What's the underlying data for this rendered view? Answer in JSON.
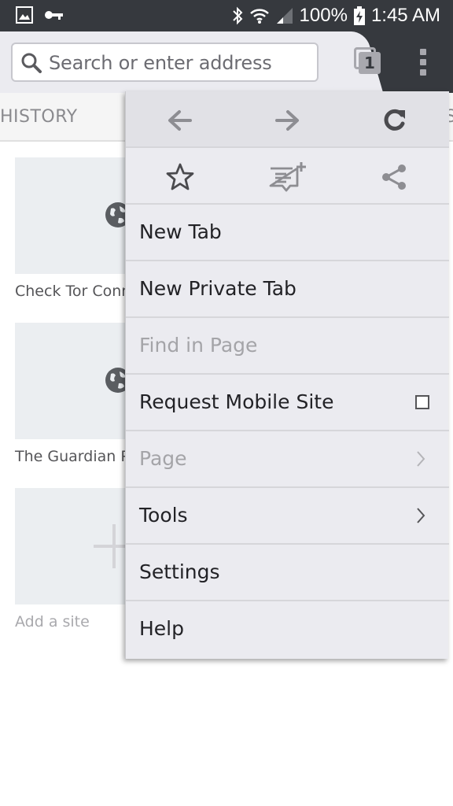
{
  "status_bar": {
    "battery": "100%",
    "time": "1:45 AM",
    "icons": [
      "gallery-icon",
      "key-icon",
      "bluetooth-icon",
      "wifi-icon",
      "signal-icon",
      "battery-charging-icon"
    ]
  },
  "toolbar": {
    "search_placeholder": "Search or enter address",
    "tab_count": "1"
  },
  "panel_tabs": {
    "history_label": "HISTORY",
    "partial_next_label": "S"
  },
  "top_sites": [
    {
      "label": "Check Tor Conne",
      "icon": "globe-icon"
    },
    {
      "label": "The Guardian Pr",
      "icon": "globe-icon"
    },
    {
      "label": "Add a site",
      "icon": "plus-icon"
    }
  ],
  "menu": {
    "nav_icons": [
      "back-arrow-icon",
      "forward-arrow-icon",
      "reload-icon"
    ],
    "action_icons": [
      "bookmark-star-icon",
      "reading-list-add-icon",
      "share-icon"
    ],
    "items": [
      {
        "label": "New Tab",
        "enabled": true
      },
      {
        "label": "New Private Tab",
        "enabled": true
      },
      {
        "label": "Find in Page",
        "enabled": false
      },
      {
        "label": "Request Mobile Site",
        "enabled": true,
        "checkbox": false
      },
      {
        "label": "Page",
        "enabled": false,
        "submenu": true
      },
      {
        "label": "Tools",
        "enabled": true,
        "submenu": true
      },
      {
        "label": "Settings",
        "enabled": true
      },
      {
        "label": "Help",
        "enabled": true
      }
    ]
  },
  "colors": {
    "chrome_dark": "#36393e",
    "menu_bg": "#ebebf0",
    "icon_gray": "#8d8d92",
    "disabled_text": "#a4a4a8"
  }
}
